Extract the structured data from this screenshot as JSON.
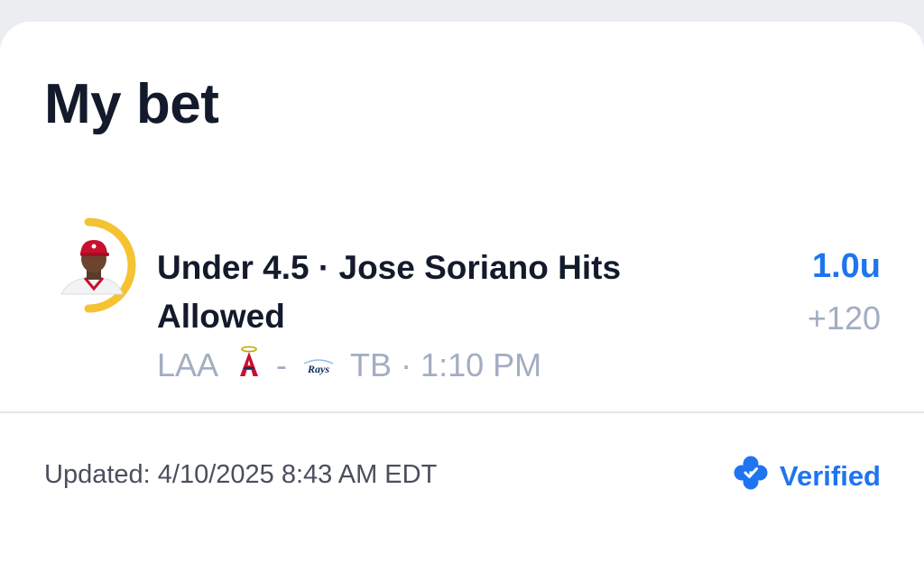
{
  "page": {
    "title": "My bet"
  },
  "bet": {
    "title": "Under 4.5 · Jose Soriano Hits Allowed",
    "stake": "1.0u",
    "odds": "+120",
    "away_team": "LAA",
    "separator": "-",
    "home_team": "TB",
    "time": "· 1:10 PM",
    "player_avatar_icon": "player-headshot",
    "progress_ring_color": "#f5c232",
    "away_logo_icon": "angels-logo",
    "home_logo_icon": "rays-logo"
  },
  "footer": {
    "updated": "Updated: 4/10/2025 8:43 AM EDT",
    "verified_label": "Verified",
    "verified_icon": "clover-icon"
  },
  "colors": {
    "accent": "#1f74f0",
    "text_primary": "#131a2b",
    "text_secondary": "#a3adc2",
    "ring": "#f5c232"
  }
}
